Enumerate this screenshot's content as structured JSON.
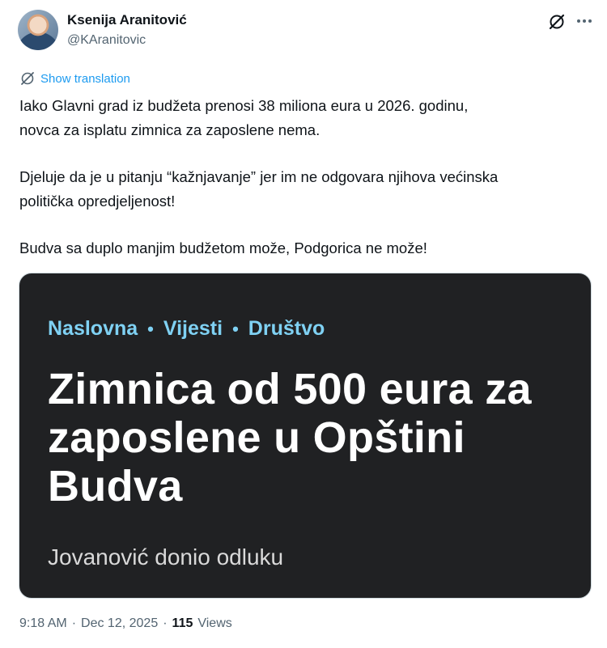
{
  "author": {
    "name": "Ksenija Aranitović",
    "handle": "@KAranitovic"
  },
  "icons": {
    "grok": "grok-icon",
    "more": "more-icon",
    "translate": "translate-icon"
  },
  "translate": {
    "label": "Show translation"
  },
  "tweet": {
    "lines": [
      "Iako Glavni grad iz budžeta prenosi 38 miliona eura u 2026. godinu,",
      "novca za isplatu zimnica za zaposlene nema.",
      "Djeluje da je u pitanju “kažnjavanje” jer im ne odgovara njihova većinska",
      "politička opredjeljenost!",
      "Budva sa duplo manjim budžetom može, Podgorica ne može!"
    ]
  },
  "card": {
    "breadcrumbs": [
      "Naslovna",
      "Vijesti",
      "Društvo"
    ],
    "separator": "•",
    "headline_lines": [
      "Zimnica od 500 eura za",
      "zaposlene u Opštini",
      "Budva"
    ],
    "subtitle": "Jovanović donio odluku",
    "colors": {
      "background": "#202123",
      "breadcrumb": "#7fd1f3",
      "headline": "#ffffff"
    }
  },
  "meta": {
    "time": "9:18 AM",
    "date": "Dec 12, 2025",
    "views_count": "115",
    "views_label": "Views",
    "separator": "·"
  }
}
